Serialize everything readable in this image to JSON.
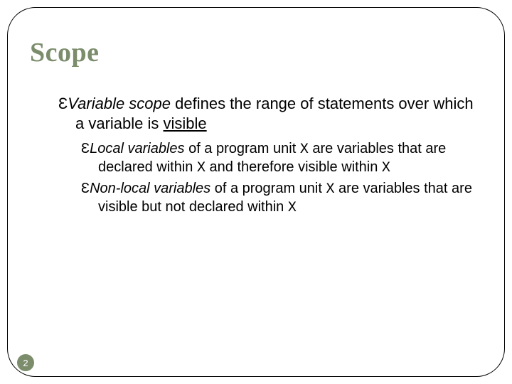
{
  "title": "Scope",
  "bullet_glyph": "Ɛ",
  "main": {
    "b1_a": "Variable scope",
    "b1_b": " defines the range of statements over which a variable is ",
    "b1_c": "visible"
  },
  "sub": {
    "s1_a": "Local variables",
    "s1_b": " of a program unit ",
    "s1_c": "X",
    "s1_d": " are variables that are declared within ",
    "s1_e": "X",
    "s1_f": " and therefore visible within ",
    "s1_g": "X",
    "s2_a": "Non-local variables",
    "s2_b": " of a program unit ",
    "s2_c": "X",
    "s2_d": " are variables that are visible but not declared within ",
    "s2_e": "X"
  },
  "page_number": "2"
}
